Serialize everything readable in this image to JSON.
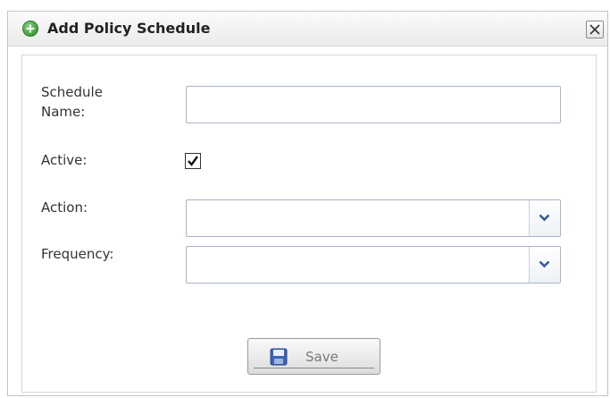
{
  "dialog": {
    "title": "Add Policy Schedule",
    "title_icon": "add-circle-icon",
    "close_icon": "close-icon"
  },
  "form": {
    "schedule_name": {
      "label": "Schedule Name:",
      "value": "",
      "placeholder": ""
    },
    "active": {
      "label": "Active:",
      "checked": true
    },
    "action": {
      "label": "Action:",
      "value": ""
    },
    "frequency": {
      "label": "Frequency:",
      "value": ""
    }
  },
  "footer": {
    "save_label": "Save",
    "save_icon": "floppy-disk-icon"
  },
  "colors": {
    "title_icon": "#3f9b3a",
    "dropdown_arrow": "#3a5a9c",
    "save_icon": "#3b63b5",
    "border": "#aab4c8"
  }
}
